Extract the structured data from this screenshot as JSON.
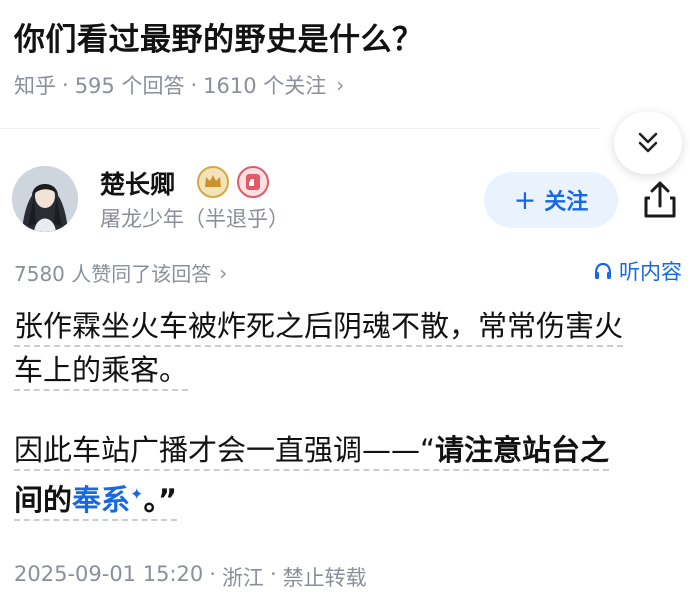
{
  "question": {
    "title": "你们看过最野的野史是什么？",
    "source": "知乎",
    "answer_count": "595 个回答",
    "follower_count": "1610 个关注",
    "separator": "·",
    "chevron": "›"
  },
  "author": {
    "name": "楚长卿",
    "bio": "屠龙少年（半退乎）",
    "follow_plus": "+",
    "follow_label": "关注"
  },
  "answer": {
    "likes_text": "7580 人赞同了该回答",
    "listen_label": "听内容",
    "paragraph1_line1": "张作霖坐火车被炸死之后阴魂不散，常常伤害火",
    "paragraph1_line2": "车上的乘客。",
    "paragraph2_line1_prefix": "因此车站广播才会一直强调——“",
    "paragraph2_line1_bold": "请注意站台之",
    "paragraph2_line2_bold": "间的",
    "paragraph2_link": "奉系",
    "paragraph2_link_mark": "✦",
    "paragraph2_suffix": "。”"
  },
  "footer": {
    "datetime": "2025-09-01 15:20",
    "location": "浙江",
    "rights": "禁止转载",
    "separator": "·"
  },
  "colors": {
    "accent": "#1768e5",
    "muted": "#8a8f99",
    "follow_bg": "#eaf2fe"
  },
  "icons": [
    "chevron-double-down-icon",
    "crown-badge-icon",
    "like-badge-icon",
    "share-icon",
    "headphones-icon"
  ]
}
